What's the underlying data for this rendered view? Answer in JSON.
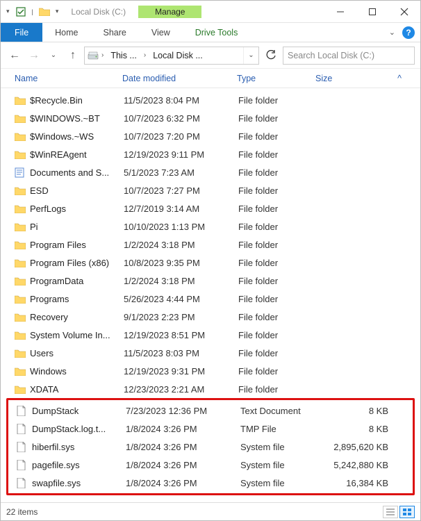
{
  "window": {
    "title": "Local Disk (C:)"
  },
  "context_tab": {
    "group_label": "Manage",
    "tool_label": "Drive Tools"
  },
  "ribbon": {
    "file": "File",
    "home": "Home",
    "share": "Share",
    "view": "View"
  },
  "address": {
    "seg1": "This ...",
    "seg2": "Local Disk ..."
  },
  "search": {
    "placeholder": "Search Local Disk (C:)"
  },
  "columns": {
    "name": "Name",
    "date": "Date modified",
    "type": "Type",
    "size": "Size"
  },
  "items": [
    {
      "icon": "folder",
      "name": "$Recycle.Bin",
      "date": "11/5/2023 8:04 PM",
      "type": "File folder",
      "size": ""
    },
    {
      "icon": "folder",
      "name": "$WINDOWS.~BT",
      "date": "10/7/2023 6:32 PM",
      "type": "File folder",
      "size": ""
    },
    {
      "icon": "folder",
      "name": "$Windows.~WS",
      "date": "10/7/2023 7:20 PM",
      "type": "File folder",
      "size": ""
    },
    {
      "icon": "folder",
      "name": "$WinREAgent",
      "date": "12/19/2023 9:11 PM",
      "type": "File folder",
      "size": ""
    },
    {
      "icon": "doc",
      "name": "Documents and S...",
      "date": "5/1/2023 7:23 AM",
      "type": "File folder",
      "size": ""
    },
    {
      "icon": "folder",
      "name": "ESD",
      "date": "10/7/2023 7:27 PM",
      "type": "File folder",
      "size": ""
    },
    {
      "icon": "folder",
      "name": "PerfLogs",
      "date": "12/7/2019 3:14 AM",
      "type": "File folder",
      "size": ""
    },
    {
      "icon": "folder",
      "name": "Pi",
      "date": "10/10/2023 1:13 PM",
      "type": "File folder",
      "size": ""
    },
    {
      "icon": "folder",
      "name": "Program Files",
      "date": "1/2/2024 3:18 PM",
      "type": "File folder",
      "size": ""
    },
    {
      "icon": "folder",
      "name": "Program Files (x86)",
      "date": "10/8/2023 9:35 PM",
      "type": "File folder",
      "size": ""
    },
    {
      "icon": "folder",
      "name": "ProgramData",
      "date": "1/2/2024 3:18 PM",
      "type": "File folder",
      "size": ""
    },
    {
      "icon": "folder",
      "name": "Programs",
      "date": "5/26/2023 4:44 PM",
      "type": "File folder",
      "size": ""
    },
    {
      "icon": "folder",
      "name": "Recovery",
      "date": "9/1/2023 2:23 PM",
      "type": "File folder",
      "size": ""
    },
    {
      "icon": "folder",
      "name": "System Volume In...",
      "date": "12/19/2023 8:51 PM",
      "type": "File folder",
      "size": ""
    },
    {
      "icon": "folder",
      "name": "Users",
      "date": "11/5/2023 8:03 PM",
      "type": "File folder",
      "size": ""
    },
    {
      "icon": "folder",
      "name": "Windows",
      "date": "12/19/2023 9:31 PM",
      "type": "File folder",
      "size": ""
    },
    {
      "icon": "folder",
      "name": "XDATA",
      "date": "12/23/2023 2:21 AM",
      "type": "File folder",
      "size": ""
    },
    {
      "icon": "file",
      "name": "DumpStack",
      "date": "7/23/2023 12:36 PM",
      "type": "Text Document",
      "size": "8 KB"
    },
    {
      "icon": "file",
      "name": "DumpStack.log.t...",
      "date": "1/8/2024 3:26 PM",
      "type": "TMP File",
      "size": "8 KB"
    },
    {
      "icon": "file",
      "name": "hiberfil.sys",
      "date": "1/8/2024 3:26 PM",
      "type": "System file",
      "size": "2,895,620 KB"
    },
    {
      "icon": "file",
      "name": "pagefile.sys",
      "date": "1/8/2024 3:26 PM",
      "type": "System file",
      "size": "5,242,880 KB"
    },
    {
      "icon": "file",
      "name": "swapfile.sys",
      "date": "1/8/2024 3:26 PM",
      "type": "System file",
      "size": "16,384 KB"
    }
  ],
  "highlight_start_index": 17,
  "status": {
    "count_text": "22 items"
  }
}
